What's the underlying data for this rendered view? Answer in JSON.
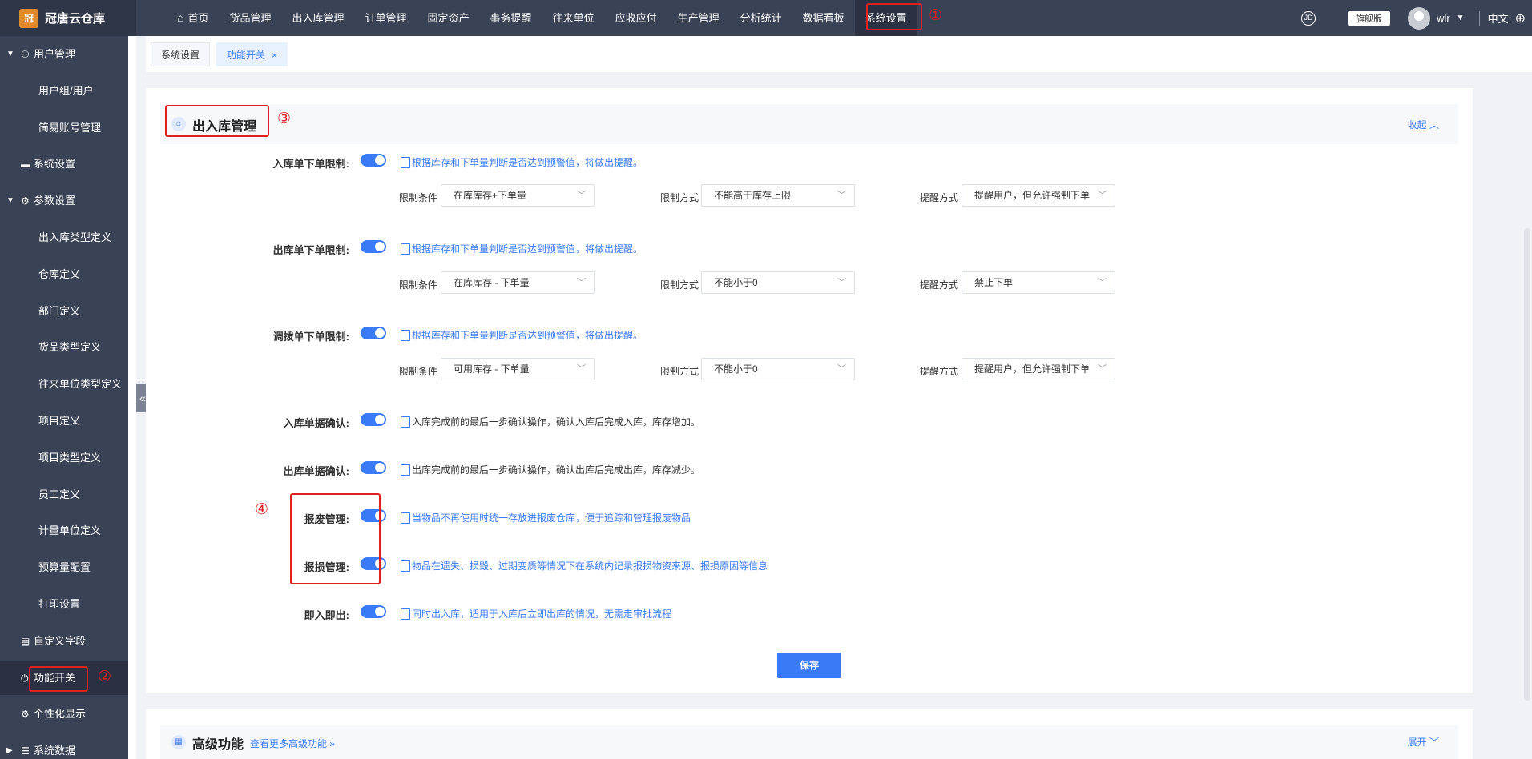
{
  "app": {
    "name": "冠唐云仓库",
    "logo_mark": "冠"
  },
  "topnav": {
    "items": [
      "首页",
      "货品管理",
      "出入库管理",
      "订单管理",
      "固定资产",
      "事务提醒",
      "往来单位",
      "应收应付",
      "生产管理",
      "分析统计",
      "数据看板",
      "系统设置"
    ],
    "active": "系统设置"
  },
  "topright": {
    "edition": "旗舰版",
    "user": "wlr",
    "language": "中文",
    "icon": "JD"
  },
  "sidebar": {
    "items": [
      {
        "label": "用户管理",
        "level": 1,
        "icon": "user-icon",
        "expanded": true
      },
      {
        "label": "用户组/用户",
        "level": 2
      },
      {
        "label": "简易账号管理",
        "level": 2
      },
      {
        "label": "系统设置",
        "level": 1,
        "icon": "monitor-icon"
      },
      {
        "label": "参数设置",
        "level": 1,
        "icon": "gear-icon",
        "expanded": true
      },
      {
        "label": "出入库类型定义",
        "level": 2
      },
      {
        "label": "仓库定义",
        "level": 2
      },
      {
        "label": "部门定义",
        "level": 2
      },
      {
        "label": "货品类型定义",
        "level": 2
      },
      {
        "label": "往来单位类型定义",
        "level": 2
      },
      {
        "label": "项目定义",
        "level": 2
      },
      {
        "label": "项目类型定义",
        "level": 2
      },
      {
        "label": "员工定义",
        "level": 2
      },
      {
        "label": "计量单位定义",
        "level": 2
      },
      {
        "label": "预算量配置",
        "level": 2
      },
      {
        "label": "打印设置",
        "level": 2
      },
      {
        "label": "自定义字段",
        "level": 1,
        "icon": "form-icon"
      },
      {
        "label": "功能开关",
        "level": 1,
        "icon": "power-icon",
        "active": true
      },
      {
        "label": "个性化显示",
        "level": 1,
        "icon": "gear-icon"
      },
      {
        "label": "系统数据",
        "level": 1,
        "icon": "database-icon"
      }
    ]
  },
  "tabs": [
    {
      "label": "系统设置"
    },
    {
      "label": "功能开关",
      "active": true,
      "close": "×"
    }
  ],
  "section": {
    "title": "出入库管理",
    "fold_label": "收起",
    "rows": [
      {
        "label": "入库单下单限制:",
        "on": true,
        "tip": "根据库存和下单量判断是否达到预警值，将做出提醒。",
        "filters": [
          {
            "label": "限制条件",
            "value": "在库库存+下单量"
          },
          {
            "label": "限制方式",
            "value": "不能高于库存上限"
          },
          {
            "label": "提醒方式",
            "value": "提醒用户，但允许强制下单"
          }
        ]
      },
      {
        "label": "出库单下单限制:",
        "on": true,
        "tip": "根据库存和下单量判断是否达到预警值，将做出提醒。",
        "filters": [
          {
            "label": "限制条件",
            "value": "在库库存 - 下单量"
          },
          {
            "label": "限制方式",
            "value": "不能小于0"
          },
          {
            "label": "提醒方式",
            "value": "禁止下单"
          }
        ]
      },
      {
        "label": "调拨单下单限制:",
        "on": true,
        "tip": "根据库存和下单量判断是否达到预警值，将做出提醒。",
        "filters": [
          {
            "label": "限制条件",
            "value": "可用库存 - 下单量"
          },
          {
            "label": "限制方式",
            "value": "不能小于0"
          },
          {
            "label": "提醒方式",
            "value": "提醒用户，但允许强制下单"
          }
        ]
      },
      {
        "label": "入库单据确认:",
        "on": true,
        "tip": "入库完成前的最后一步确认操作，确认入库后完成入库，库存增加。"
      },
      {
        "label": "出库单据确认:",
        "on": true,
        "tip": "出库完成前的最后一步确认操作，确认出库后完成出库，库存减少。"
      },
      {
        "label": "报废管理:",
        "on": true,
        "tip": "当物品不再使用时统一存放进报废仓库，便于追踪和管理报废物品"
      },
      {
        "label": "报损管理:",
        "on": true,
        "tip": "物品在遗失、损毁、过期变质等情况下在系统内记录报损物资来源、报损原因等信息"
      },
      {
        "label": "即入即出:",
        "on": true,
        "tip": "同时出入库，适用于入库后立即出库的情况，无需走审批流程"
      }
    ],
    "save_label": "保存"
  },
  "advanced": {
    "title": "高级功能",
    "more": "查看更多高级功能 »",
    "expand_label": "展开"
  },
  "annotations": [
    "①",
    "②",
    "③",
    "④"
  ],
  "colors": {
    "primary": "#3a7af6",
    "nav_bg": "#3a4356",
    "annotation": "#e02020"
  }
}
